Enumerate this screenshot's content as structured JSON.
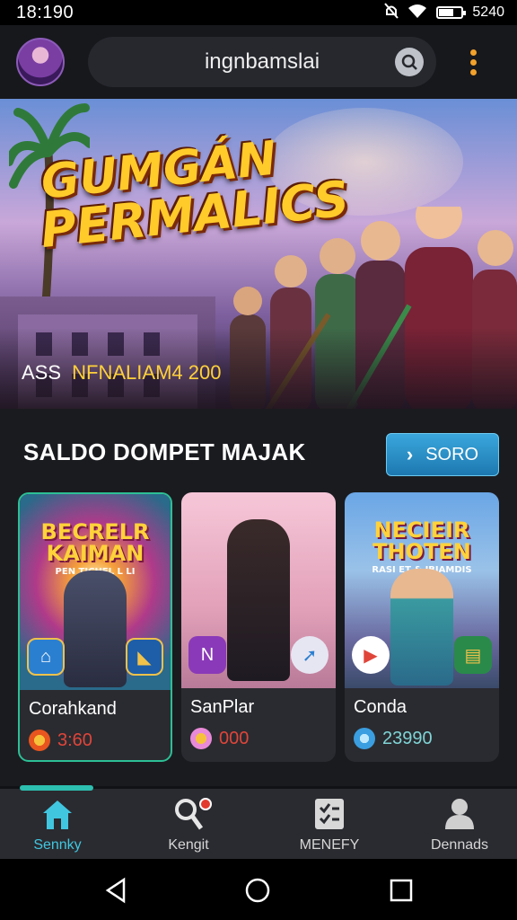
{
  "status_bar": {
    "time": "18:190",
    "right_text": "5240",
    "icons": [
      "mute-icon",
      "wifi-icon",
      "battery-icon"
    ]
  },
  "header": {
    "search_value": "ingnbamslai",
    "avatar": "avatar",
    "menu_icon": "more-vertical-icon"
  },
  "banner": {
    "title_line1": "GUMGÁN",
    "title_line2": "PERMALICS",
    "caption_prefix": "ASS",
    "caption_highlight": "NFNALIAM4 200"
  },
  "section": {
    "title": "SALDO DOMPET  MAJAK",
    "more_label": "SORO"
  },
  "cards": [
    {
      "art_title_1": "BECRELR",
      "art_title_2": "KAIMAN",
      "art_subtitle": "PEN TICHEL L LI",
      "name": "Corahkand",
      "price": "3:60",
      "price_color": "#e0453a",
      "coin_color": "#f08a1c"
    },
    {
      "art_title_1": "",
      "art_title_2": "",
      "art_subtitle": "",
      "name": "SanPlar",
      "price": "000",
      "price_color": "#e0453a",
      "coin_color": "#e98ad8"
    },
    {
      "art_title_1": "NECIEIR",
      "art_title_2": "THOTEN",
      "art_subtitle": "RASI ET & IBIAMDIS",
      "name": "Conda",
      "price": "23990",
      "price_color": "#7fd4d6",
      "coin_color": "#3a9ee0"
    }
  ],
  "bottom_nav": [
    {
      "label": "Sennky",
      "icon": "home-icon",
      "active": true
    },
    {
      "label": "Kengit",
      "icon": "search-person-icon",
      "active": false
    },
    {
      "label": "MENEFY",
      "icon": "checklist-icon",
      "active": false
    },
    {
      "label": "Dennads",
      "icon": "profile-icon",
      "active": false
    }
  ],
  "system_nav": [
    "back-icon",
    "home-circle-icon",
    "recents-icon"
  ],
  "colors": {
    "accent": "#41c6e0",
    "button": "#1d78b0",
    "title_gold": "#ffcb2a",
    "selected_border": "#2dbf95"
  }
}
